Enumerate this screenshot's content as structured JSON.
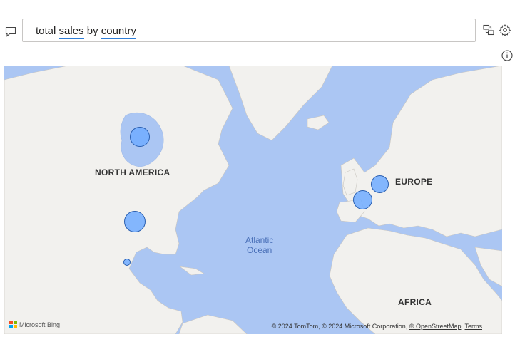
{
  "qa": {
    "words": [
      {
        "text": "total",
        "term": false
      },
      {
        "text": "sales",
        "term": true
      },
      {
        "text": "by",
        "term": false
      },
      {
        "text": "country",
        "term": true
      }
    ]
  },
  "map": {
    "regions": {
      "north_america": "NORTH AMERICA",
      "europe": "EUROPE",
      "africa": "AFRICA"
    },
    "ocean": {
      "line1": "Atlantic",
      "line2": "Ocean"
    },
    "attribution": {
      "text": "© 2024 TomTom, © 2024 Microsoft Corporation, ",
      "osm_link": "© OpenStreetMap",
      "terms_link": "Terms"
    },
    "provider": "Microsoft Bing"
  },
  "colors": {
    "bubble_fill": "#70acff",
    "bubble_stroke": "#2a5fb0",
    "ocean": "#abc6f3",
    "land": "#f2f1ee",
    "qa_underline": "#2f7ed8"
  },
  "icons": [
    "chat-icon",
    "share-visual-icon",
    "settings-gear-icon",
    "info-icon"
  ]
}
